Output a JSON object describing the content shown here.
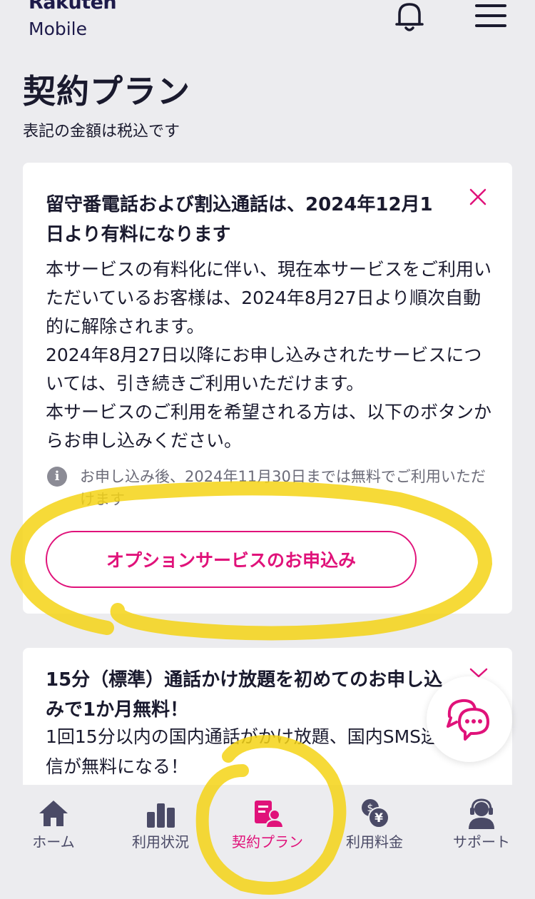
{
  "header": {
    "logo_top": "Rakuten",
    "logo_bottom": "Mobile",
    "icons": [
      "bell-icon",
      "hamburger-menu-icon"
    ]
  },
  "page": {
    "title": "契約プラン",
    "tax_note": "表記の金額は税込です"
  },
  "notice_card": {
    "title": "留守番電話および割込通話は、2024年12月1日より有料になります",
    "body": "本サービスの有料化に伴い、現在本サービスをご利用いただいているお客様は、2024年8月27日より順次自動的に解除されます。\n2024年8月27日以降にお申し込みされたサービスについては、引き続きご利用いただけます。\n本サービスのご利用を希望される方は、以下のボタンからお申し込みください。",
    "info_icon_label": "i",
    "info_text": "お申し込み後、2024年11月30日までは無料でご利用いただけます",
    "apply_button": "オプションサービスのお申込み"
  },
  "promo_card": {
    "title": "15分（標準）通話かけ放題を初めてのお申し込みで1か月無料！",
    "body": "1回15分以内の国内通話がかけ放題、国内SMS送受信が無料になる！"
  },
  "tabs": [
    {
      "label": "ホーム",
      "icon": "home-icon",
      "active": false
    },
    {
      "label": "利用状況",
      "icon": "bar-chart-icon",
      "active": false
    },
    {
      "label": "契約プラン",
      "icon": "contract-plan-icon",
      "active": true
    },
    {
      "label": "利用料金",
      "icon": "yen-coins-icon",
      "active": false
    },
    {
      "label": "サポート",
      "icon": "support-headset-icon",
      "active": false
    }
  ],
  "colors": {
    "accent": "#e0127a",
    "navy": "#1d1a4a",
    "tab_inactive": "#4a4a66",
    "highlight": "#f5d315"
  }
}
